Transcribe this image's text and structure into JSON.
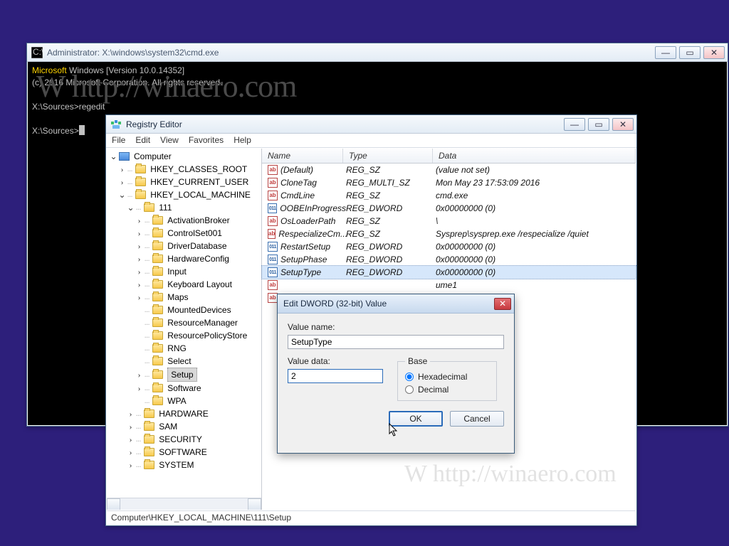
{
  "desktop": {
    "watermark": "W http://winaero.com"
  },
  "cmd": {
    "title": "Administrator: X:\\windows\\system32\\cmd.exe",
    "lines": {
      "l1a": "Microsoft",
      "l1b": " Windows [Version 10.0.14352]",
      "l2": "(c) 2016 Microsoft Corporation. All rights reserved.",
      "l3": "",
      "l4": "X:\\Sources>regedit",
      "l5": "",
      "l6": "X:\\Sources>"
    },
    "icon_glyph": "C:\\"
  },
  "regedit": {
    "title": "Registry Editor",
    "menu": {
      "file": "File",
      "edit": "Edit",
      "view": "View",
      "favorites": "Favorites",
      "help": "Help"
    },
    "status": "Computer\\HKEY_LOCAL_MACHINE\\111\\Setup",
    "tree": {
      "root": "Computer",
      "hkcr": "HKEY_CLASSES_ROOT",
      "hkcu": "HKEY_CURRENT_USER",
      "hklm": "HKEY_LOCAL_MACHINE",
      "k111": "111",
      "items": {
        "a": "ActivationBroker",
        "b": "ControlSet001",
        "c": "DriverDatabase",
        "d": "HardwareConfig",
        "e": "Input",
        "f": "Keyboard Layout",
        "g": "Maps",
        "h": "MountedDevices",
        "i": "ResourceManager",
        "j": "ResourcePolicyStore",
        "k": "RNG",
        "l": "Select",
        "m": "Setup",
        "n": "Software",
        "o": "WPA"
      },
      "siblings": {
        "a": "HARDWARE",
        "b": "SAM",
        "c": "SECURITY",
        "d": "SOFTWARE",
        "e": "SYSTEM"
      }
    },
    "cols": {
      "name": "Name",
      "type": "Type",
      "data": "Data"
    },
    "values": [
      {
        "icon": "ab",
        "name": "(Default)",
        "type": "REG_SZ",
        "data": "(value not set)"
      },
      {
        "icon": "ab",
        "name": "CloneTag",
        "type": "REG_MULTI_SZ",
        "data": "Mon May 23 17:53:09 2016"
      },
      {
        "icon": "ab",
        "name": "CmdLine",
        "type": "REG_SZ",
        "data": "cmd.exe"
      },
      {
        "icon": "01",
        "name": "OOBEInProgress",
        "type": "REG_DWORD",
        "data": "0x00000000 (0)"
      },
      {
        "icon": "ab",
        "name": "OsLoaderPath",
        "type": "REG_SZ",
        "data": "\\"
      },
      {
        "icon": "ab",
        "name": "RespecializeCm...",
        "type": "REG_SZ",
        "data": "Sysprep\\sysprep.exe /respecialize /quiet"
      },
      {
        "icon": "01",
        "name": "RestartSetup",
        "type": "REG_DWORD",
        "data": "0x00000000 (0)"
      },
      {
        "icon": "01",
        "name": "SetupPhase",
        "type": "REG_DWORD",
        "data": "0x00000000 (0)"
      },
      {
        "icon": "01",
        "name": "SetupType",
        "type": "REG_DWORD",
        "data": "0x00000000 (0)",
        "sel": true
      }
    ],
    "partial_tail": "ume1"
  },
  "dialog": {
    "title": "Edit DWORD (32-bit) Value",
    "close_glyph": "✕",
    "value_name_label": "Value name:",
    "value_name": "SetupType",
    "value_data_label": "Value data:",
    "value_data": "2",
    "base_label": "Base",
    "hex_label": "Hexadecimal",
    "dec_label": "Decimal",
    "ok": "OK",
    "cancel": "Cancel"
  },
  "glyphs": {
    "min": "—",
    "max": "▭",
    "close": "✕",
    "tw_open": "⌄",
    "tw_closed": "›",
    "ab": "ab",
    "z": "011"
  }
}
